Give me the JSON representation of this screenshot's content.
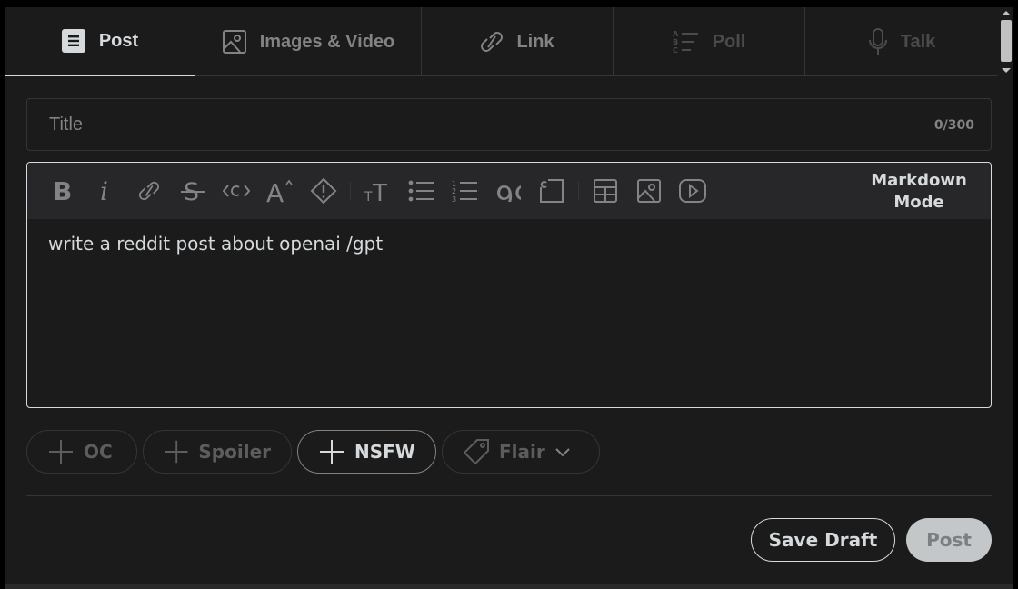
{
  "tabs": [
    {
      "label": "Post",
      "icon": "post-icon",
      "state": "active"
    },
    {
      "label": "Images & Video",
      "icon": "image-icon",
      "state": "normal"
    },
    {
      "label": "Link",
      "icon": "link-icon",
      "state": "normal"
    },
    {
      "label": "Poll",
      "icon": "poll-icon",
      "state": "disabled"
    },
    {
      "label": "Talk",
      "icon": "microphone-icon",
      "state": "disabled"
    }
  ],
  "title": {
    "placeholder": "Title",
    "value": "",
    "counter": "0/300"
  },
  "toolbar": {
    "buttons": [
      "bold",
      "italic",
      "link",
      "strikethrough",
      "inline-code",
      "superscript",
      "spoiler",
      "heading",
      "bulleted-list",
      "numbered-list",
      "quote-block",
      "code-block",
      "table",
      "image",
      "video"
    ],
    "markdown_mode": "Markdown Mode"
  },
  "editor": {
    "text": "write a reddit post about openai /gpt"
  },
  "tags": {
    "oc": "OC",
    "spoiler": "Spoiler",
    "nsfw": "NSFW",
    "flair": "Flair"
  },
  "actions": {
    "save_draft": "Save Draft",
    "post": "Post"
  },
  "colors": {
    "background": "#1b1b1b",
    "border": "#343536",
    "text": "#d7dadc",
    "muted": "#818384"
  }
}
